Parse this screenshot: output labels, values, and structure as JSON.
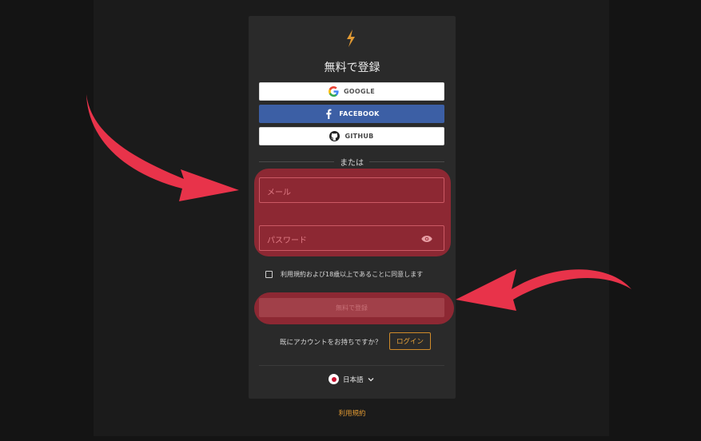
{
  "colors": {
    "accent": "#e29a33",
    "facebook": "#3c5fa5",
    "highlight": "#b42837",
    "arrow": "#e8334a"
  },
  "brand": {
    "logo_icon": "lightning-bolt-icon"
  },
  "form": {
    "title": "無料で登録",
    "oauth": {
      "google_label": "GOOGLE",
      "facebook_label": "FACEBOOK",
      "github_label": "GITHUB"
    },
    "or_label": "または",
    "email_placeholder": "メール",
    "password_placeholder": "パスワード",
    "agree_label": "利用規約および18歳以上であることに同意します",
    "submit_label": "無料で登録",
    "have_account_text": "既にアカウントをお持ちですか？",
    "login_label": "ログイン",
    "language_label": "日本語"
  },
  "footer": {
    "terms_link": "利用規約"
  }
}
